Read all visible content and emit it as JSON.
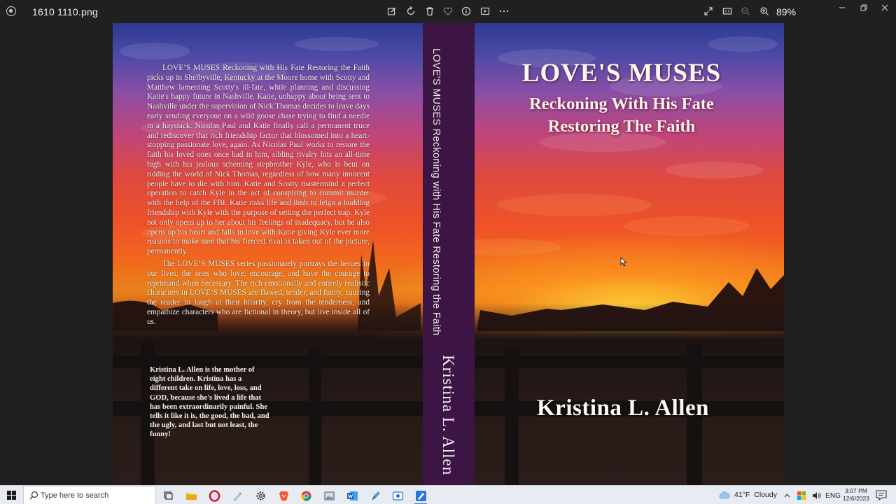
{
  "titlebar": {
    "file_name": "1610  1110.png",
    "zoom_level": "89%"
  },
  "toolbar": {
    "icons": [
      "edit-icon",
      "rotate-icon",
      "delete-icon",
      "favorite-icon",
      "info-icon",
      "slideshow-icon",
      "more-icon",
      "fullscreen-icon",
      "actual-size-icon",
      "zoom-out-icon",
      "zoom-in-icon"
    ]
  },
  "window_controls": [
    "minimize-icon",
    "restore-icon",
    "close-icon"
  ],
  "book": {
    "back_blurb_1": "LOVE’S MUSES Reckoning with His Fate Restoring the Faith picks up in Shelbyville, Kentucky at the Moore home with Scotty and Matthew lamenting Scotty's ill-fate, while planning and discussing Katie's happy future in Nashville. Katie, unhappy about being sent to Nashville under the supervision of Nick Thomas decides to leave days early sending everyone on a wild goose chase trying to find a needle in a haystack. Nicolas Paul and Katie finally call a permanent truce and rediscover that rich friendship factor that blossomed into a heart-stopping passionate love, again. As Nicolas Paul works to restore the faith his loved ones once had in him, sibling rivalry hits an all-time high with his jealous scheming stepbrother Kyle, who is bent on ridding the world of Nick Thomas, regardless of how many innocent people have to die with him. Katie and Scotty mastermind a perfect operation to catch Kyle in the act of conspiring to commit murder with the help of the FBI. Katie risks life and limb to feign a budding friendship with Kyle with the purpose of setting the perfect trap. Kyle not only opens up to her about his feelings of inadequacy, but he also opens up his heart and falls in love with Katie giving Kyle ever more reasons to make sure that his fiercest rival is taken out of the picture, permanently.",
    "back_blurb_2": "The LOVE’S MUSES series passionately portrays the heroes in our lives, the ones who love, encourage, and have the courage to reprimand when necessary. The rich emotionally and entirely realistic characters in LOVE’S MUSES are flawed, tender, and funny, causing the reader to laugh at their hilarity, cry from the tenderness, and empathize characters who are fictional in theory, but live inside all of us.",
    "author_bio": "Kristina L. Allen is the mother of eight children. Kristina has a different take on life, love, loss, and GOD, because she's lived a life that has been extraordinarily painful. She tells it like it is, the good, the bad, and the ugly, and last but not least, the funny!",
    "spine_title": "LOVE'S MUSES  Reckoning with His Fate Restoring the Faith",
    "spine_author": "Kristina L. Allen",
    "front_title": "LOVE'S MUSES",
    "front_subtitle_1": "Reckoning With His Fate",
    "front_subtitle_2": "Restoring The Faith",
    "front_author": "Kristina  L.  Allen"
  },
  "taskbar": {
    "search_placeholder": "Type here to search",
    "apps": [
      "task-view-icon",
      "file-explorer-icon",
      "opera-icon",
      "notepad-icon",
      "settings-icon",
      "brave-icon",
      "chrome-icon",
      "photos-app-icon",
      "word-icon",
      "pen-app-icon",
      "screen-capture-icon",
      "paint-app-icon"
    ],
    "weather_temp": "41°F",
    "weather_desc": "Cloudy",
    "language": "ENG",
    "time": "3:07 PM",
    "date": "12/6/2023"
  },
  "colors": {
    "titlebar_bg": "#202020",
    "spine": "#3c1545",
    "taskbar_bg": "#e8ecf2",
    "accent": "#4a7fcf"
  }
}
